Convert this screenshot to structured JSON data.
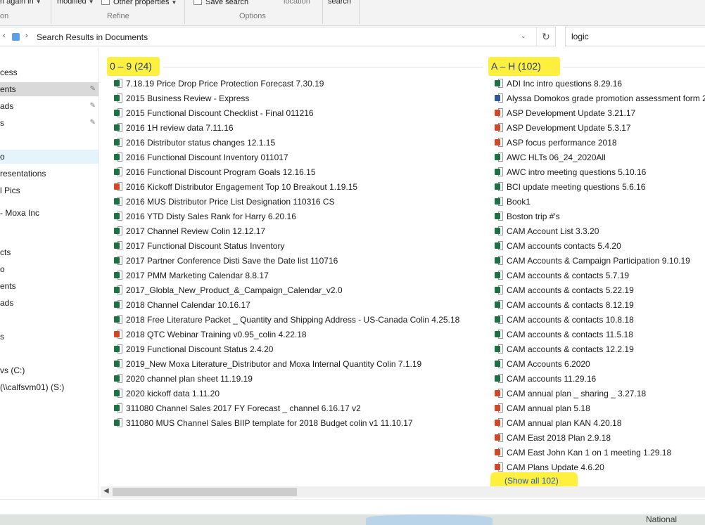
{
  "ribbon": {
    "again_label": "n again in",
    "modified_label": "modified",
    "other_props_label": "Other properties",
    "save_search_label": "Save search",
    "location_label": "location",
    "search_label": "search",
    "refine_label": "Refine",
    "options_label": "Options",
    "on_label": "on"
  },
  "address": {
    "path": "Search Results in Documents"
  },
  "search": {
    "query": "logic"
  },
  "nav": {
    "items": [
      {
        "label": "cess"
      },
      {
        "label": "ents"
      },
      {
        "label": "ads"
      },
      {
        "label": "s"
      },
      {
        "label": "o"
      },
      {
        "label": "resentations"
      },
      {
        "label": "l Pics"
      },
      {
        "label": " - Moxa Inc"
      },
      {
        "label": "cts"
      },
      {
        "label": "o"
      },
      {
        "label": "ents"
      },
      {
        "label": "ads"
      },
      {
        "label": "s"
      },
      {
        "label": "vs (C:)"
      },
      {
        "label": " (\\\\calfsvm01) (S:)"
      }
    ]
  },
  "groups": [
    {
      "header": "0 – 9 (24)",
      "items": [
        {
          "name": "7.18.19 Price Drop Price Protection Forecast 7.30.19",
          "icon": "xl"
        },
        {
          "name": "2015 Business Review - Express",
          "icon": "xl"
        },
        {
          "name": "2015 Functional Discount Checklist - Final 011216",
          "icon": "xl"
        },
        {
          "name": "2016 1H review data 7.11.16",
          "icon": "xl"
        },
        {
          "name": "2016 Distributor status changes 12.1.15",
          "icon": "xl"
        },
        {
          "name": "2016 Functional Discount Inventory 011017",
          "icon": "xl"
        },
        {
          "name": "2016 Functional Discount Program Goals 12.16.15",
          "icon": "xl"
        },
        {
          "name": "2016 Kickoff Distributor Engagement Top 10 Breakout 1.19.15",
          "icon": "pp"
        },
        {
          "name": "2016 MUS Distributor Price List Designation 110316 CS",
          "icon": "xl"
        },
        {
          "name": "2016 YTD Disty Sales Rank for Harry 6.20.16",
          "icon": "xl"
        },
        {
          "name": "2017 Channel Review Colin 12.12.17",
          "icon": "xl"
        },
        {
          "name": "2017 Functional Discount Status Inventory",
          "icon": "xl"
        },
        {
          "name": "2017 Partner Conference Disti Save the Date list 110716",
          "icon": "xl"
        },
        {
          "name": "2017 PMM Marketing Calendar 8.8.17",
          "icon": "xl"
        },
        {
          "name": "2017_Globla_New_Product_&_Campaign_Calendar_v2.0",
          "icon": "xl"
        },
        {
          "name": "2018 Channel Calendar 10.16.17",
          "icon": "xl"
        },
        {
          "name": "2018 Free Literature Packet _ Quantity and Shipping Address - US-Canada Colin 4.25.18",
          "icon": "xl"
        },
        {
          "name": "2018 QTC Webinar Training v0.95_colin 4.22.18",
          "icon": "pp"
        },
        {
          "name": "2019 Functional Discount Status 2.4.20",
          "icon": "xl"
        },
        {
          "name": "2019_New Moxa Literature_Distributor and Moxa Internal Quantity Colin 7.1.19",
          "icon": "xl"
        },
        {
          "name": "2020 channel plan sheet 11.19.19",
          "icon": "xl"
        },
        {
          "name": "2020 kickoff data 1.11.20",
          "icon": "xl"
        },
        {
          "name": "311080 Channel Sales 2017 FY Forecast _ channel 6.16.17 v2",
          "icon": "xs"
        },
        {
          "name": "311080 MUS Channel Sales BIIP template for 2018 Budget colin v1 11.10.17",
          "icon": "xl"
        }
      ]
    },
    {
      "header": "A – H (102)",
      "show_all": "(Show all 102)",
      "items": [
        {
          "name": "ADI Inc intro questions 8.29.16",
          "icon": "xl"
        },
        {
          "name": "Alyssa Domokos grade promotion assessment form 2",
          "icon": "wd"
        },
        {
          "name": "ASP Development Update 3.21.17",
          "icon": "pp"
        },
        {
          "name": "ASP Development Update 5.3.17",
          "icon": "pp"
        },
        {
          "name": "ASP focus performance 2018",
          "icon": "pp"
        },
        {
          "name": "AWC HLTs 06_24_2020All",
          "icon": "xl"
        },
        {
          "name": "AWC intro meeting questions 5.10.16",
          "icon": "xl"
        },
        {
          "name": "BCI update meeting questions 5.6.16",
          "icon": "xl"
        },
        {
          "name": "Book1",
          "icon": "xl"
        },
        {
          "name": "Boston trip #'s",
          "icon": "xl"
        },
        {
          "name": "CAM Account List 3.3.20",
          "icon": "xs"
        },
        {
          "name": "CAM accounts  contacts 5.4.20",
          "icon": "xl"
        },
        {
          "name": "CAM Accounts & Campaign Participation 9.10.19",
          "icon": "xl"
        },
        {
          "name": "CAM accounts & contacts 5.7.19",
          "icon": "xl"
        },
        {
          "name": "CAM accounts & contacts 5.22.19",
          "icon": "xl"
        },
        {
          "name": "CAM accounts & contacts 8.12.19",
          "icon": "xl"
        },
        {
          "name": "CAM accounts & contacts 10.8.18",
          "icon": "xl"
        },
        {
          "name": "CAM accounts & contacts 11.5.18",
          "icon": "xl"
        },
        {
          "name": "CAM accounts & contacts 12.2.19",
          "icon": "xl"
        },
        {
          "name": "CAM Accounts 6.2020",
          "icon": "xl"
        },
        {
          "name": "CAM accounts 11.29.16",
          "icon": "xs"
        },
        {
          "name": "CAM annual plan _ sharing _ 3.27.18",
          "icon": "pp"
        },
        {
          "name": "CAM annual plan 5.18",
          "icon": "pp"
        },
        {
          "name": "CAM annual plan KAN 4.20.18",
          "icon": "pp"
        },
        {
          "name": "CAM East 2018 Plan 2.9.18",
          "icon": "pp"
        },
        {
          "name": "CAM East John Kan 1 on 1 meeting 1.29.18",
          "icon": "pp"
        },
        {
          "name": "CAM Plans Update 4.6.20",
          "icon": "pp"
        }
      ]
    }
  ],
  "desktop": {
    "label": "National"
  },
  "colors": {
    "highlight": "#ffef3f",
    "header_text": "#1f3d7a",
    "link": "#1f5fbf",
    "excel": "#1e7145",
    "powerpoint": "#d24726",
    "word": "#2b579a"
  }
}
